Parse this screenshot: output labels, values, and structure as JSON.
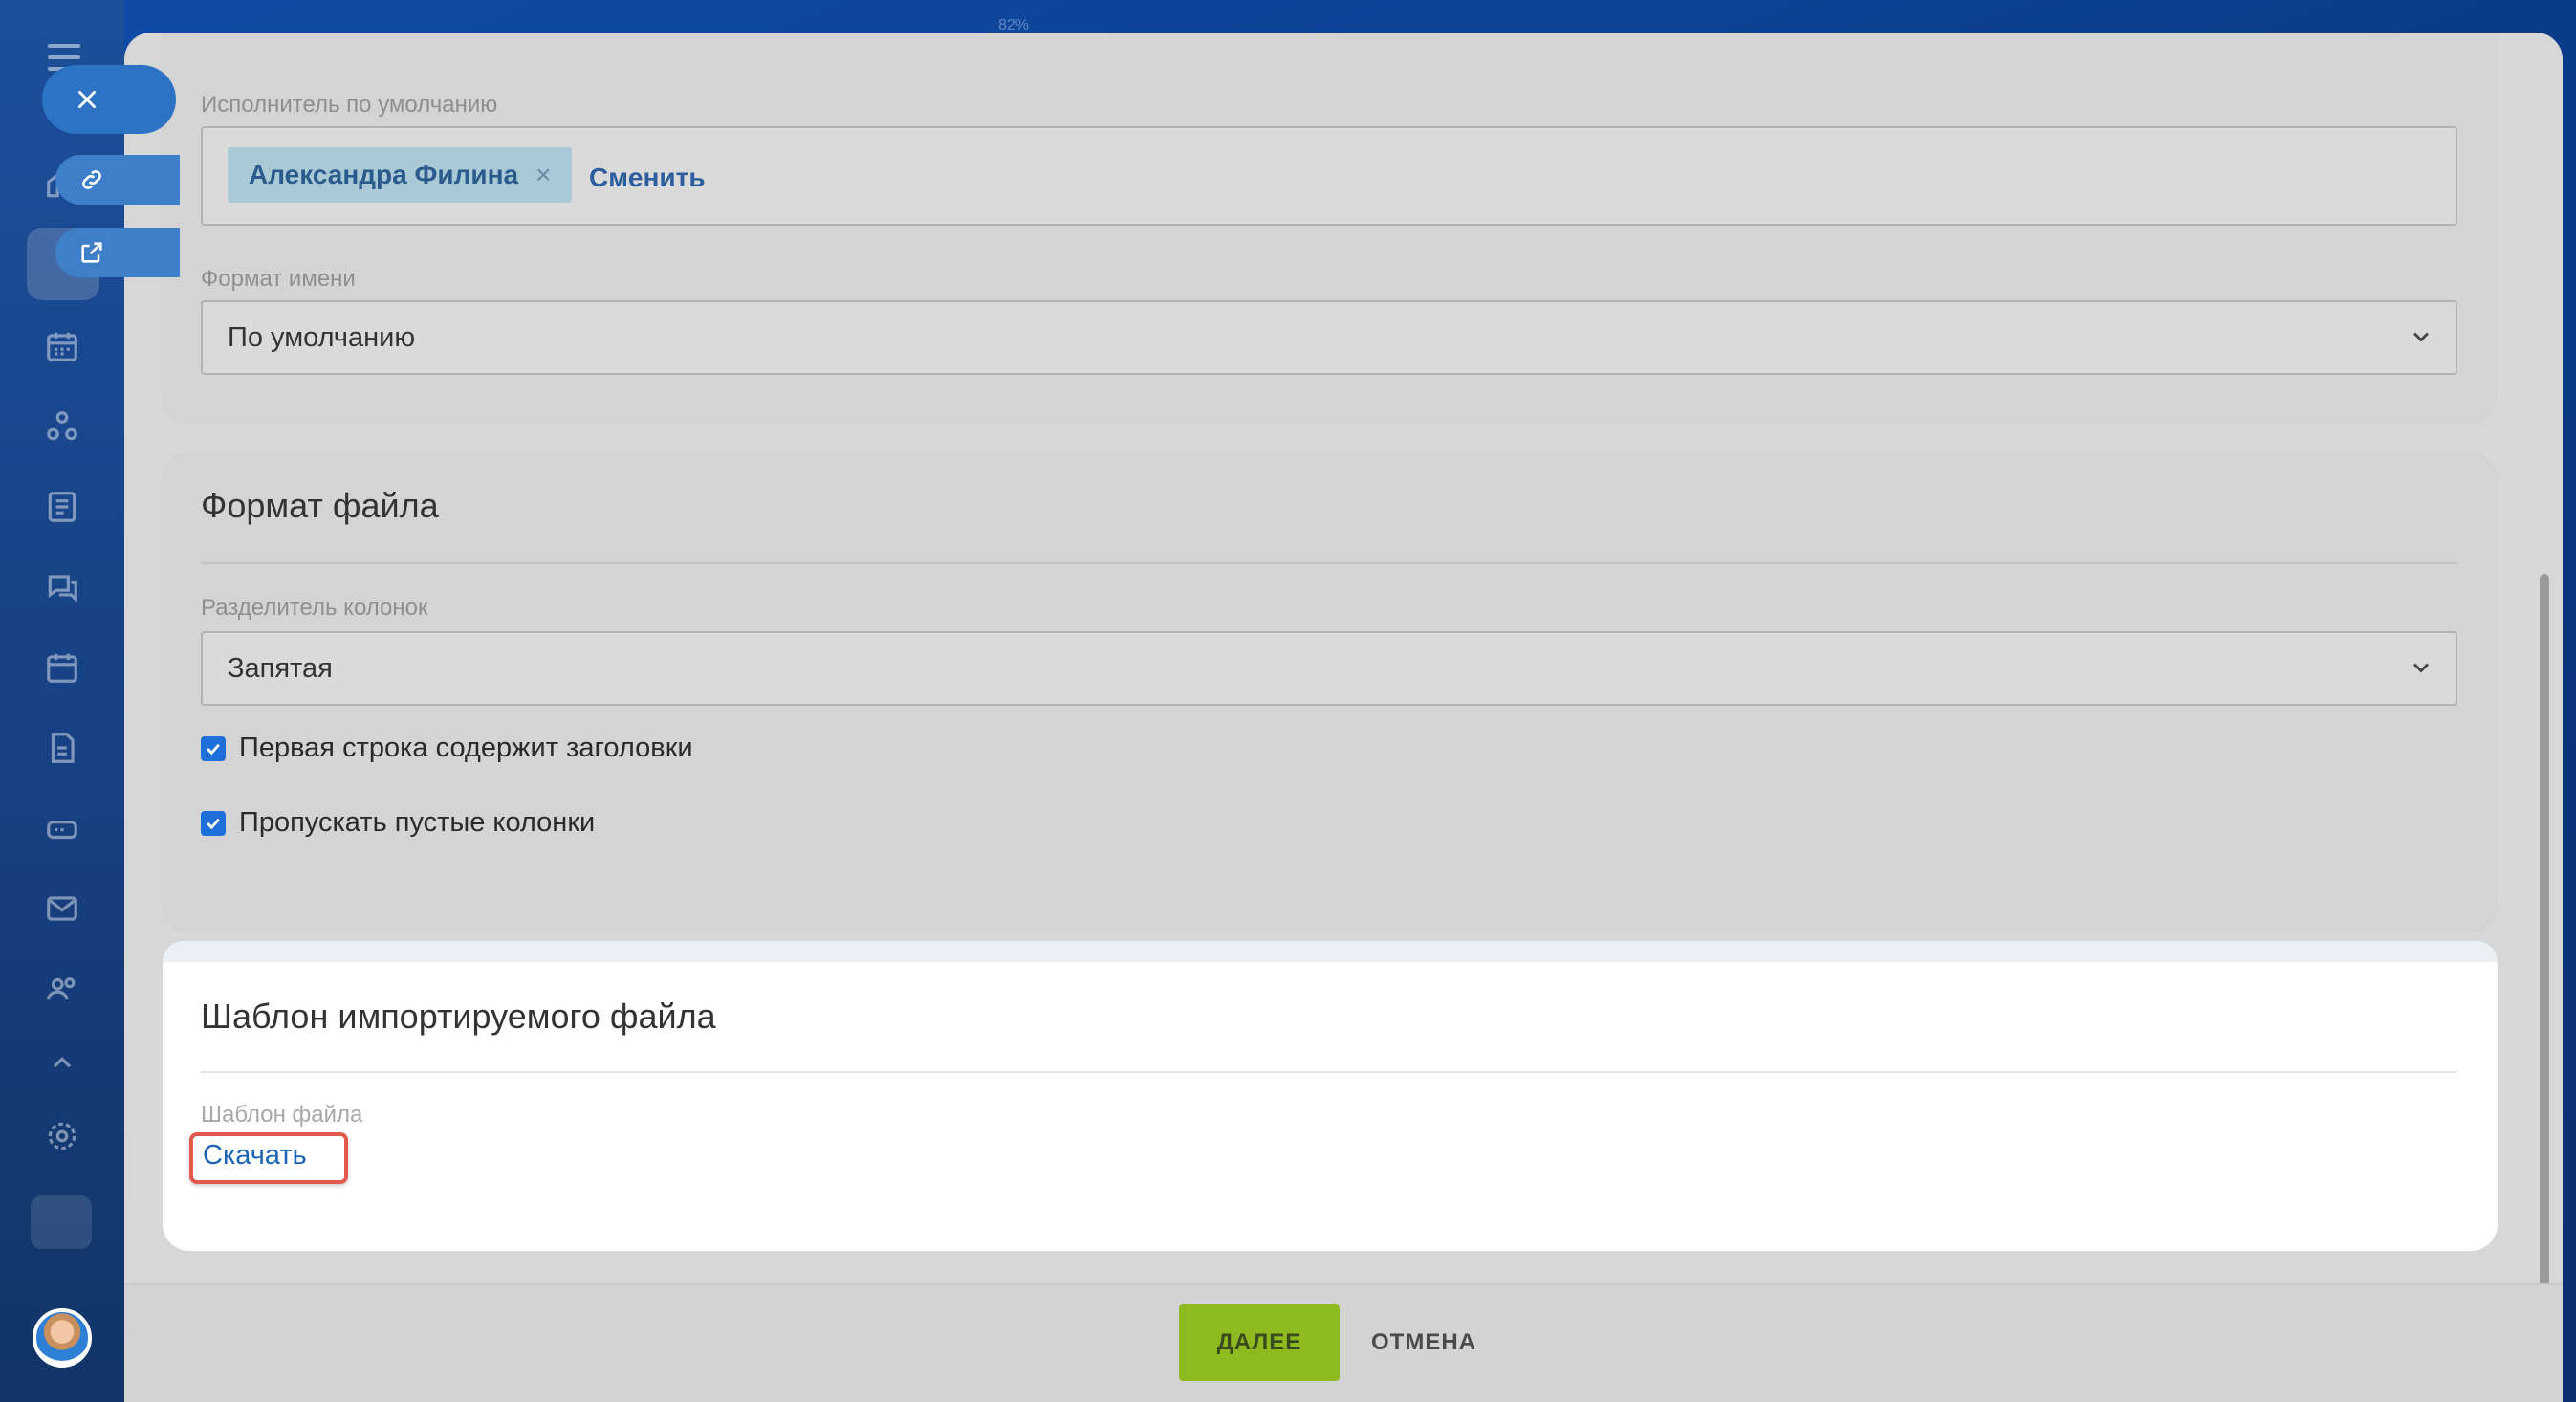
{
  "top_indicator": "82%",
  "sidebar": {
    "icons": [
      "menu-icon",
      "home-icon",
      "tasks-icon",
      "calendar-grid-icon",
      "automation-icon",
      "reports-icon",
      "chat-icon",
      "calendar-icon",
      "document-icon",
      "storage-icon",
      "mail-icon",
      "contacts-icon",
      "collapse-icon",
      "settings-icon"
    ]
  },
  "slider_controls": {
    "close_icon": "close-icon",
    "copy_link_icon": "link-icon",
    "open_new_window_icon": "external-link-icon"
  },
  "responsible": {
    "label": "Исполнитель по умолчанию",
    "tag_name": "Александра Филина",
    "tag_remove": "×",
    "change_link": "Сменить"
  },
  "name_format": {
    "label": "Формат имени",
    "value": "По умолчанию"
  },
  "file_format": {
    "title": "Формат файла",
    "separator_label": "Разделитель колонок",
    "separator_value": "Запятая",
    "checkbox_headers": "Первая строка содержит заголовки",
    "checkbox_skip_empty": "Пропускать пустые колонки",
    "checkbox_headers_checked": true,
    "checkbox_skip_empty_checked": true
  },
  "template": {
    "title": "Шаблон импортируемого файла",
    "file_label": "Шаблон файла",
    "download_link": "Скачать"
  },
  "footer": {
    "next_label": "ДАЛЕЕ",
    "cancel_label": "ОТМЕНА"
  },
  "colors": {
    "accent_green": "#8dbb1f",
    "link_blue": "#1c64b4",
    "highlight_red": "#e2594f"
  }
}
